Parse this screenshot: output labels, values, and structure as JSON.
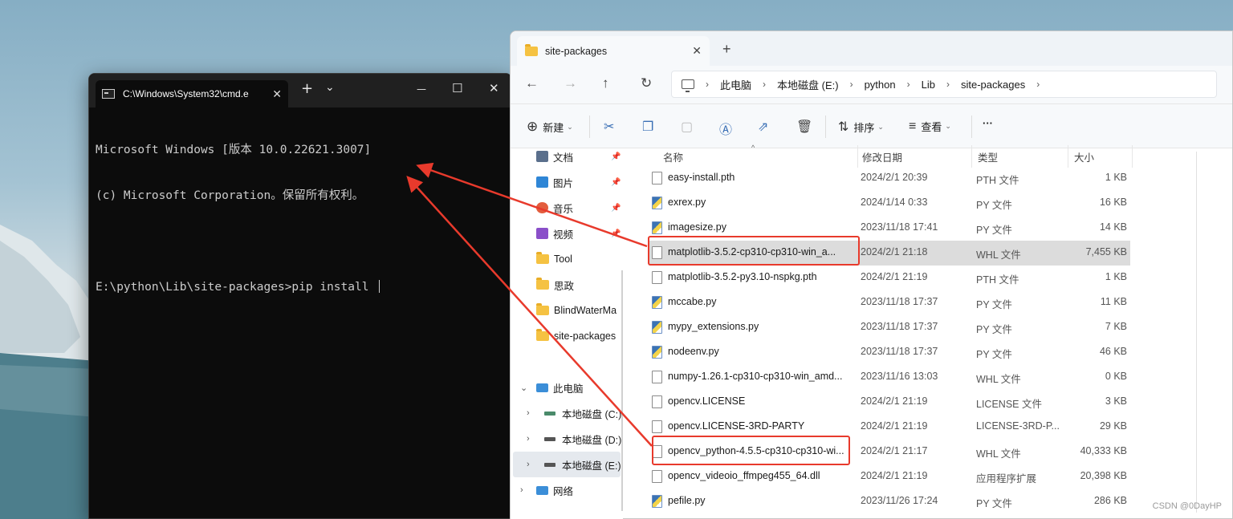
{
  "cmd": {
    "tab_title": "C:\\Windows\\System32\\cmd.e",
    "close_tab": "✕",
    "new_tab": "+",
    "dropdown": "⌄",
    "minimize": "—",
    "maximize": "☐",
    "close": "✕",
    "lines": [
      "Microsoft Windows [版本 10.0.22621.3007]",
      "(c) Microsoft Corporation。保留所有权利。",
      "",
      "E:\\python\\Lib\\site-packages>pip install "
    ]
  },
  "explorer": {
    "tab_title": "site-packages",
    "tab_close": "✕",
    "new_tab": "+",
    "nav": {
      "back": "←",
      "forward": "→",
      "up": "↑",
      "refresh": "↻"
    },
    "breadcrumb": [
      "此电脑",
      "本地磁盘 (E:)",
      "python",
      "Lib",
      "site-packages"
    ],
    "crumb_sep": "›",
    "toolbar": {
      "new": "新建",
      "sort": "排序",
      "view": "查看",
      "more": "···"
    },
    "nav_pane": {
      "quick": [
        {
          "label": "文档",
          "icon": "document-icon",
          "color": "#5a6f8c"
        },
        {
          "label": "图片",
          "icon": "picture-icon",
          "color": "#2f86d6"
        },
        {
          "label": "音乐",
          "icon": "music-icon",
          "color": "#e35d3d"
        },
        {
          "label": "视频",
          "icon": "video-icon",
          "color": "#8a4fc9"
        },
        {
          "label": "Tool",
          "icon": "folder-icon"
        },
        {
          "label": "思政",
          "icon": "folder-icon"
        },
        {
          "label": "BlindWaterMa",
          "icon": "folder-icon"
        },
        {
          "label": "site-packages",
          "icon": "folder-icon"
        }
      ],
      "this_pc": "此电脑",
      "drives": [
        "本地磁盘 (C:)",
        "本地磁盘 (D:)",
        "本地磁盘 (E:)"
      ],
      "network": "网络"
    },
    "columns": {
      "name": "名称",
      "date": "修改日期",
      "type": "类型",
      "size": "大小"
    },
    "files": [
      {
        "name": "easy-install.pth",
        "date": "2024/2/1 20:39",
        "type": "PTH 文件",
        "size": "1 KB",
        "icon": "file-icon"
      },
      {
        "name": "exrex.py",
        "date": "2024/1/14 0:33",
        "type": "PY 文件",
        "size": "16 KB",
        "icon": "python-file-icon"
      },
      {
        "name": "imagesize.py",
        "date": "2023/11/18 17:41",
        "type": "PY 文件",
        "size": "14 KB",
        "icon": "python-file-icon"
      },
      {
        "name": "matplotlib-3.5.2-cp310-cp310-win_a...",
        "date": "2024/2/1 21:18",
        "type": "WHL 文件",
        "size": "7,455 KB",
        "icon": "file-icon"
      },
      {
        "name": "matplotlib-3.5.2-py3.10-nspkg.pth",
        "date": "2024/2/1 21:19",
        "type": "PTH 文件",
        "size": "1 KB",
        "icon": "file-icon"
      },
      {
        "name": "mccabe.py",
        "date": "2023/11/18 17:37",
        "type": "PY 文件",
        "size": "11 KB",
        "icon": "python-file-icon"
      },
      {
        "name": "mypy_extensions.py",
        "date": "2023/11/18 17:37",
        "type": "PY 文件",
        "size": "7 KB",
        "icon": "python-file-icon"
      },
      {
        "name": "nodeenv.py",
        "date": "2023/11/18 17:37",
        "type": "PY 文件",
        "size": "46 KB",
        "icon": "python-file-icon"
      },
      {
        "name": "numpy-1.26.1-cp310-cp310-win_amd...",
        "date": "2023/11/16 13:03",
        "type": "WHL 文件",
        "size": "0 KB",
        "icon": "file-icon"
      },
      {
        "name": "opencv.LICENSE",
        "date": "2024/2/1 21:19",
        "type": "LICENSE 文件",
        "size": "3 KB",
        "icon": "file-icon"
      },
      {
        "name": "opencv.LICENSE-3RD-PARTY",
        "date": "2024/2/1 21:19",
        "type": "LICENSE-3RD-P...",
        "size": "29 KB",
        "icon": "file-icon"
      },
      {
        "name": "opencv_python-4.5.5-cp310-cp310-wi...",
        "date": "2024/2/1 21:17",
        "type": "WHL 文件",
        "size": "40,333 KB",
        "icon": "file-icon"
      },
      {
        "name": "opencv_videoio_ffmpeg455_64.dll",
        "date": "2024/2/1 21:19",
        "type": "应用程序扩展",
        "size": "20,398 KB",
        "icon": "dll-file-icon"
      },
      {
        "name": "pefile.py",
        "date": "2023/11/26 17:24",
        "type": "PY 文件",
        "size": "286 KB",
        "icon": "python-file-icon"
      }
    ],
    "selected_index": 3
  },
  "annotation_color": "#e83a2c",
  "watermark": "CSDN @0DayHP"
}
